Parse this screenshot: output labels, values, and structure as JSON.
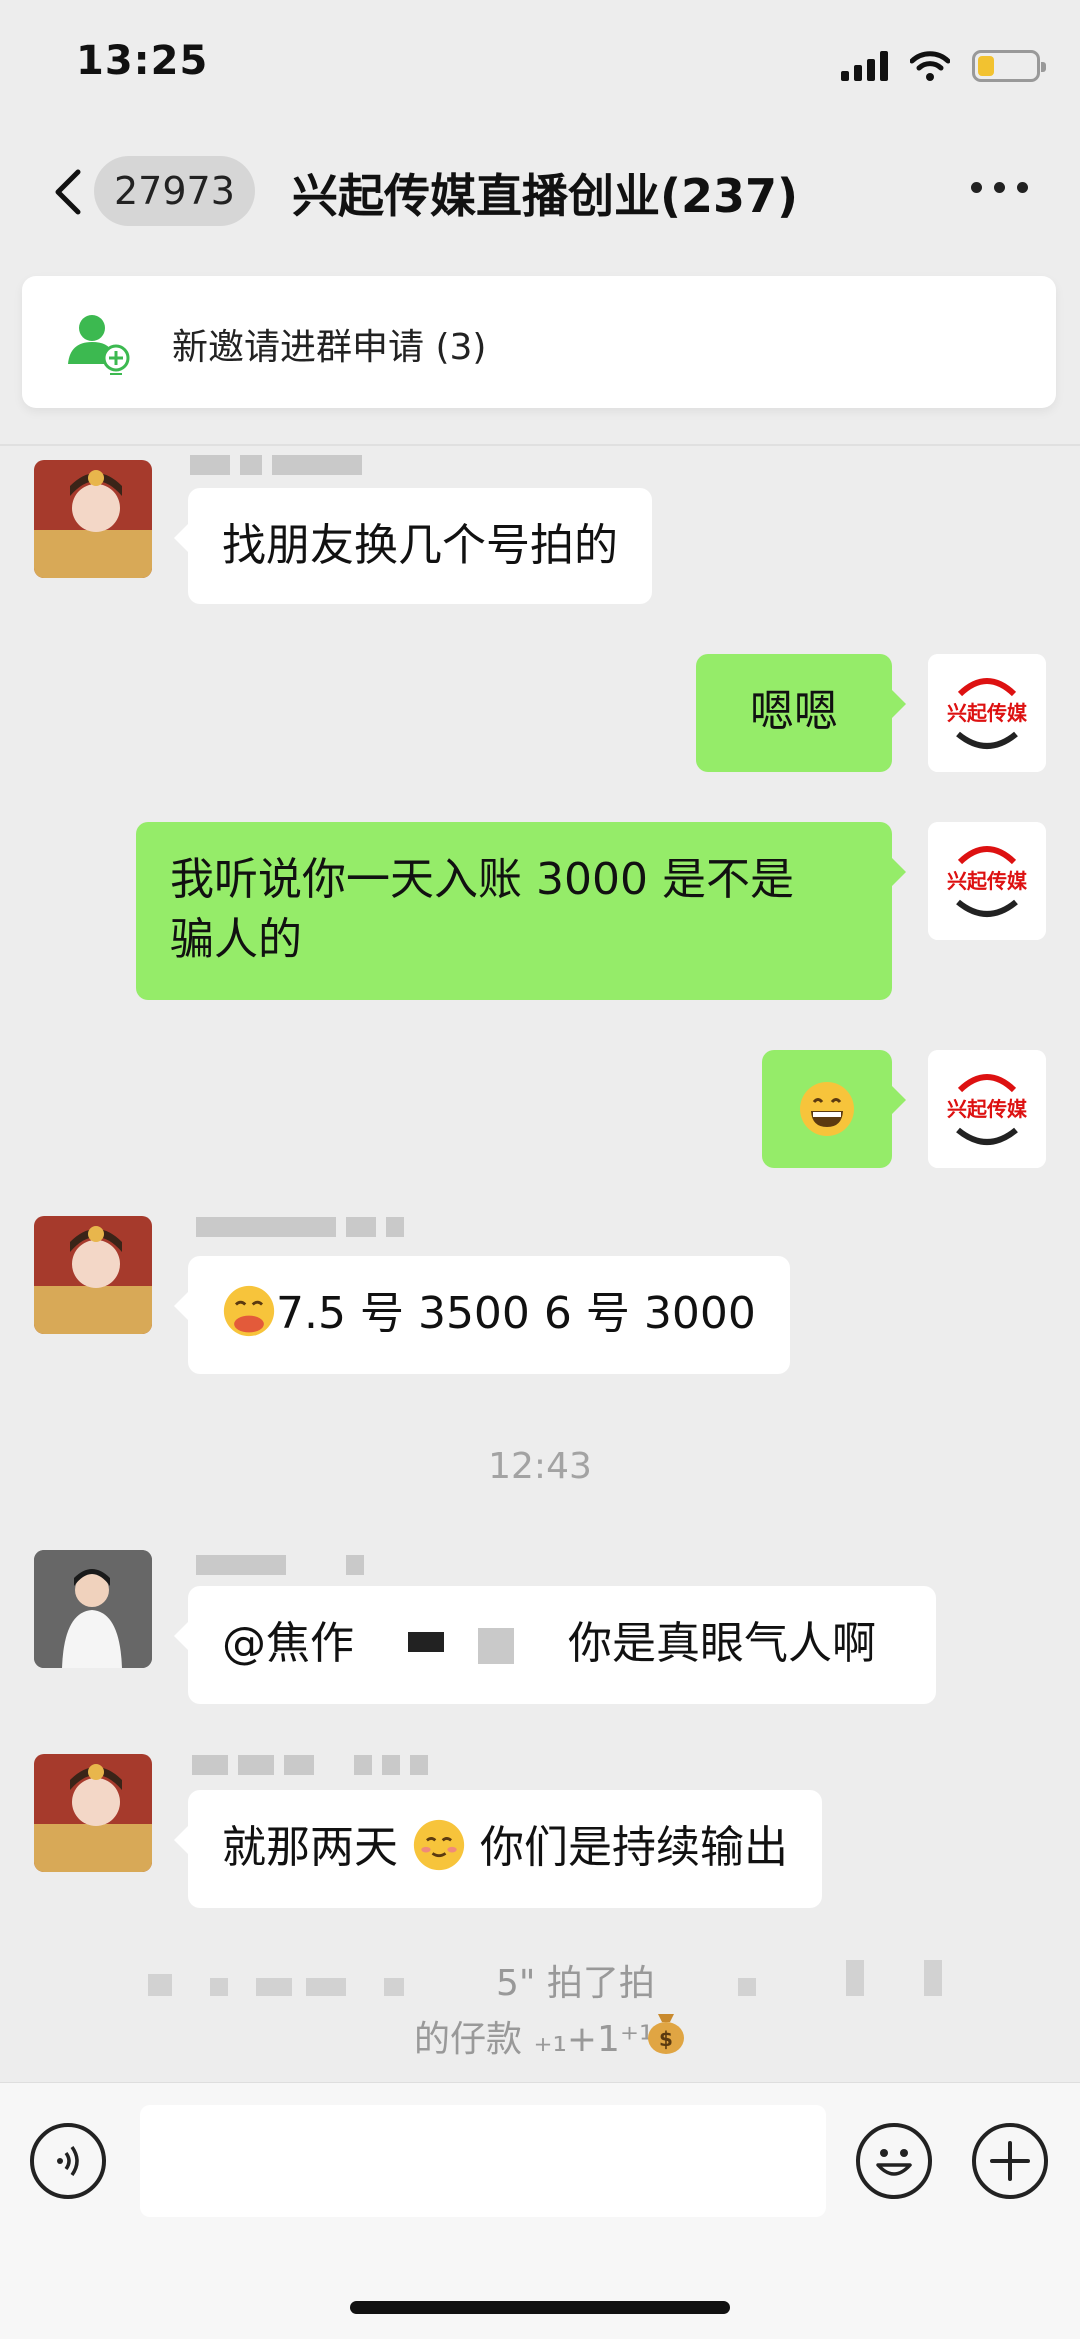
{
  "status_bar": {
    "time": "13:25"
  },
  "nav": {
    "unread_count": "27973",
    "title": "兴起传媒直播创业(237)"
  },
  "notice": {
    "text": "新邀请进群申请 (3)"
  },
  "messages": [
    {
      "side": "left",
      "text": "找朋友换几个号拍的"
    },
    {
      "side": "right",
      "text": "嗯嗯"
    },
    {
      "side": "right",
      "line1": "我听说你一天入账 3000 是不是",
      "line2": "骗人的"
    },
    {
      "side": "right",
      "emoji": "grinning-face"
    },
    {
      "side": "left",
      "emoji": "face-with-hand-over-mouth",
      "text": "7.5 号 3500 6 号 3000"
    },
    {
      "side": "left",
      "mention": "@焦作",
      "text": "你是真眼气人啊"
    },
    {
      "side": "left",
      "text_before": "就那两天",
      "emoji": "smiling-face",
      "text_after": "你们是持续输出"
    }
  ],
  "timestamp": "12:43",
  "system": {
    "line1": "5\" 拍了拍",
    "line2": "的仔款 ₊₁+1⁺¹"
  },
  "avatar_logo_text": "兴起传媒",
  "colors": {
    "right_bubble": "#95ec69",
    "left_bubble": "#ffffff",
    "background": "#ededed"
  }
}
